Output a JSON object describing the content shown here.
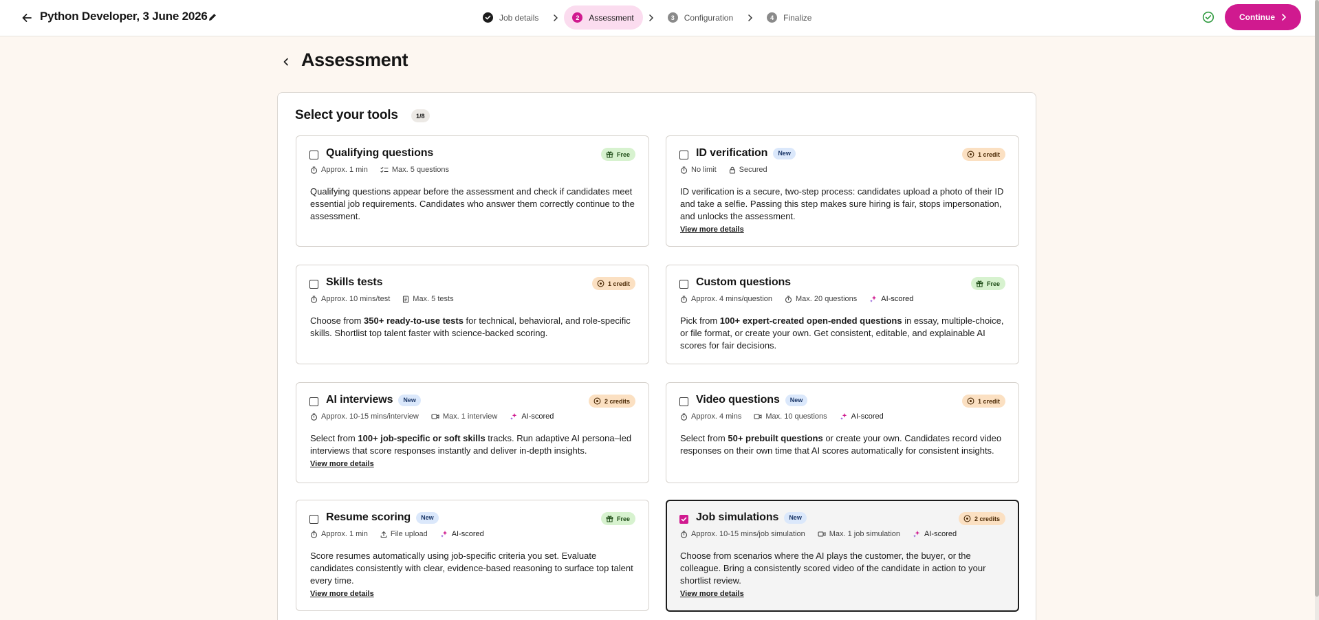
{
  "header": {
    "job_title": "Python Developer, 3 June 2026",
    "steps": [
      {
        "num": "",
        "label": "Job details"
      },
      {
        "num": "2",
        "label": "Assessment"
      },
      {
        "num": "3",
        "label": "Configuration"
      },
      {
        "num": "4",
        "label": "Finalize"
      }
    ],
    "continue_label": "Continue"
  },
  "page": {
    "title": "Assessment",
    "section_title": "Select your tools",
    "counter": "1/8"
  },
  "colors": {
    "accent": "#d01a8f",
    "free_badge": "#d7f2cf",
    "credit_badge": "#fbe0c2",
    "new_badge": "#dbe8fb",
    "background": "#fdf7f1"
  },
  "cards": [
    {
      "title": "Qualifying questions",
      "new": "",
      "price": "Free",
      "price_icon": "gift-icon",
      "checked": false,
      "meta": [
        "Approx. 1 min",
        "Max. 5 questions"
      ],
      "desc": [
        "Qualifying questions appear before the assessment and check if candidates meet essential job requirements. Candidates who answer them correctly continue to the assessment."
      ],
      "link": ""
    },
    {
      "title": "ID verification",
      "new": "New",
      "price": "1 credit",
      "price_icon": "credit-icon",
      "checked": false,
      "meta": [
        "No limit",
        "Secured"
      ],
      "desc": [
        "ID verification is a secure, two-step process: candidates upload a photo of their ID and take a selfie. Passing this step makes sure hiring is fair, stops impersonation, and unlocks the assessment."
      ],
      "link": "View more details"
    },
    {
      "title": "Skills tests",
      "new": "",
      "price": "1 credit",
      "price_icon": "credit-icon",
      "checked": false,
      "meta": [
        "Approx. 10 mins/test",
        "Max. 5 tests"
      ],
      "desc": [
        "Choose from ",
        "350+ ready-to-use tests",
        " for technical, behavioral, and role-specific skills. Shortlist top talent faster with science-backed scoring."
      ],
      "link": ""
    },
    {
      "title": "Custom questions",
      "new": "",
      "price": "Free",
      "price_icon": "gift-icon",
      "checked": false,
      "meta": [
        "Approx. 4 mins/question",
        "Max. 20 questions",
        "AI-scored"
      ],
      "desc": [
        "Pick from ",
        "100+ expert-created open-ended questions",
        " in essay, multiple-choice, or file format, or create your own. Get consistent, editable, and explainable AI scores for fair decisions."
      ],
      "link": ""
    },
    {
      "title": "AI interviews",
      "new": "New",
      "price": "2 credits",
      "price_icon": "credit-icon",
      "checked": false,
      "meta": [
        "Approx. 10-15 mins/interview",
        "Max. 1 interview",
        "AI-scored"
      ],
      "desc": [
        "Select from ",
        "100+ job-specific or soft skills",
        " tracks. Run adaptive AI persona–led interviews that score responses instantly and deliver in-depth insights."
      ],
      "link": "View more details"
    },
    {
      "title": "Video questions",
      "new": "New",
      "price": "1 credit",
      "price_icon": "credit-icon",
      "checked": false,
      "meta": [
        "Approx. 4 mins",
        "Max. 10 questions",
        "AI-scored"
      ],
      "desc": [
        "Select from ",
        "50+ prebuilt questions",
        " or create your own. Candidates record video responses on their own time that AI scores automatically for consistent insights."
      ],
      "link": ""
    },
    {
      "title": "Resume scoring",
      "new": "New",
      "price": "Free",
      "price_icon": "gift-icon",
      "checked": false,
      "meta": [
        "Approx. 1 min",
        "File upload",
        "AI-scored"
      ],
      "desc": [
        "Score resumes automatically using job-specific criteria you set. Evaluate candidates consistently with clear, evidence-based reasoning to surface top talent every time."
      ],
      "link": "View more details"
    },
    {
      "title": "Job simulations",
      "new": "New",
      "price": "2 credits",
      "price_icon": "credit-icon",
      "checked": true,
      "meta": [
        "Approx. 10-15 mins/job simulation",
        "Max. 1 job simulation",
        "AI-scored"
      ],
      "desc": [
        "Choose from scenarios where the AI plays the customer, the buyer, or the colleague. Bring a consistently scored video of the candidate in action to your shortlist review."
      ],
      "link": "View more details"
    }
  ]
}
